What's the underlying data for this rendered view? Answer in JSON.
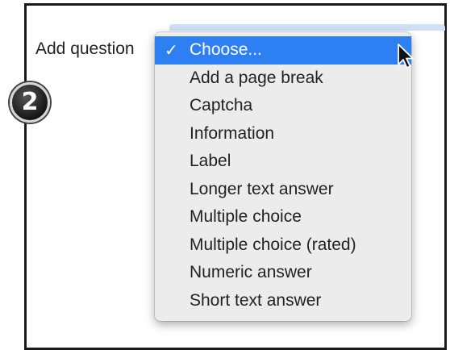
{
  "form": {
    "add_question_label": "Add question"
  },
  "step": {
    "number": "2"
  },
  "menu": {
    "check_glyph": "✓",
    "items": [
      "Choose...",
      "Add a page break",
      "Captcha",
      "Information",
      "Label",
      "Longer text answer",
      "Multiple choice",
      "Multiple choice (rated)",
      "Numeric answer",
      "Short text answer"
    ],
    "selected_item": "Choose..."
  },
  "colors": {
    "selection": "#2e7ff2",
    "menu_background": "#ececec"
  },
  "icons": {
    "cursor": "mouse-pointer-icon",
    "check": "checkmark-icon"
  }
}
